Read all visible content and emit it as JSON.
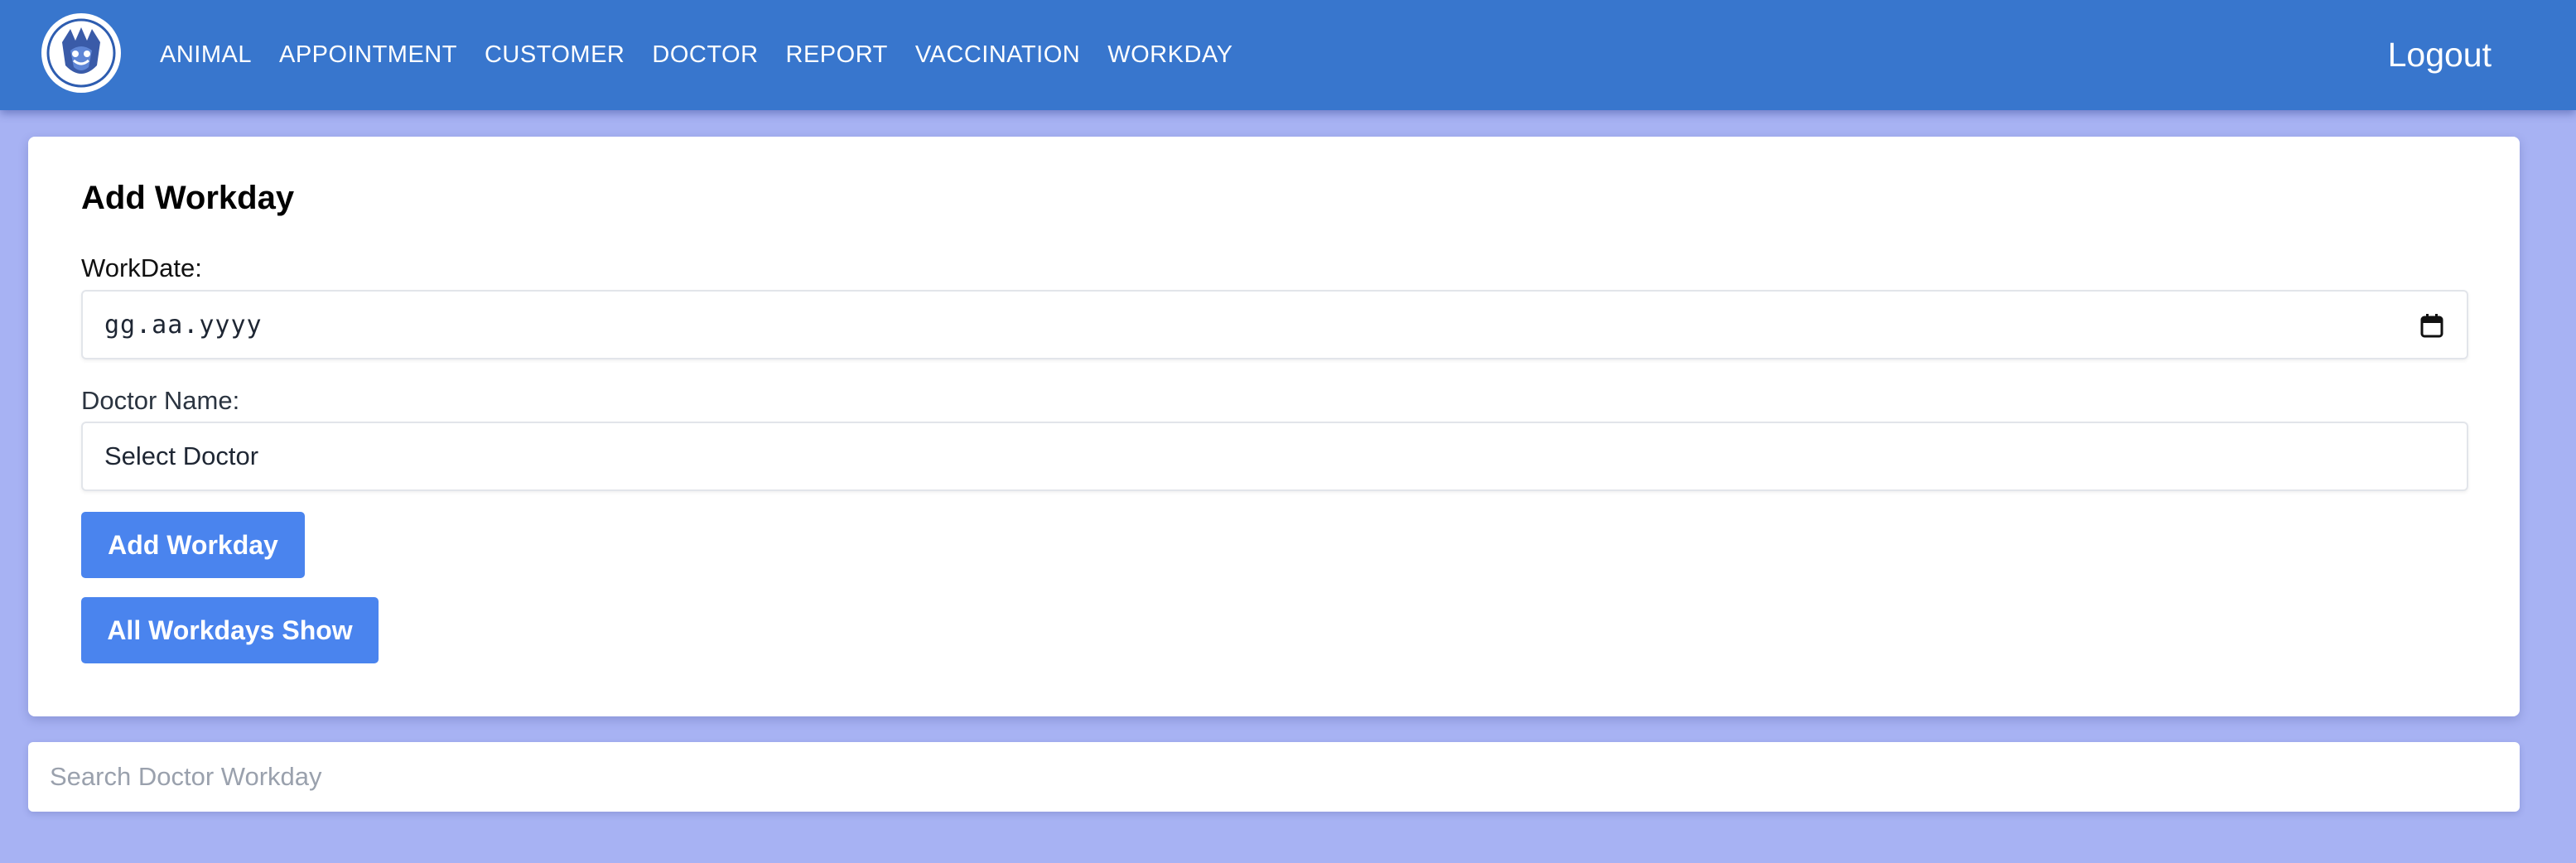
{
  "nav": {
    "logo_icon": "paw-shield-logo-icon",
    "links": [
      "ANIMAL",
      "APPOINTMENT",
      "CUSTOMER",
      "DOCTOR",
      "REPORT",
      "VACCINATION",
      "WORKDAY"
    ],
    "logout_label": "Logout"
  },
  "form": {
    "title": "Add Workday",
    "workdate_label": "WorkDate:",
    "workdate_placeholder": "gg.aa.yyyy",
    "calendar_icon": "calendar-icon",
    "doctor_label": "Doctor Name:",
    "doctor_selected": "Select Doctor",
    "add_button_label": "Add Workday",
    "all_button_label": "All Workdays Show"
  },
  "search": {
    "placeholder": "Search Doctor Workday"
  },
  "colors": {
    "navbar": "#3876cd",
    "background": "#a7b2f3",
    "button": "#4a84ee"
  }
}
